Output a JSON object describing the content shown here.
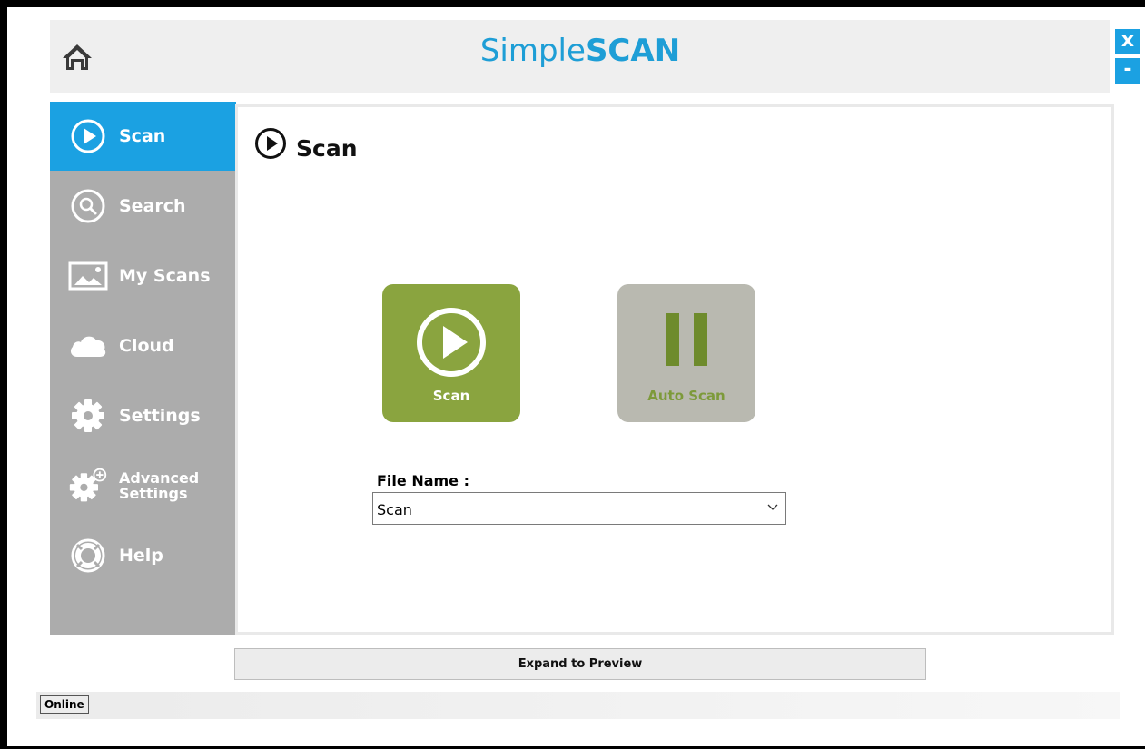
{
  "app": {
    "title_light": "Simple",
    "title_bold": "SCAN",
    "close_glyph": "x",
    "minimize_glyph": "-"
  },
  "colors": {
    "accent": "#1ba1e2",
    "sidebar": "#acacac",
    "scan_tile": "#8aa43f",
    "auto_scan_tile": "#b9b9b0"
  },
  "sidebar": {
    "items": [
      {
        "label": "Scan",
        "icon": "play-circle-icon",
        "active": true
      },
      {
        "label": "Search",
        "icon": "search-icon"
      },
      {
        "label": "My Scans",
        "icon": "image-icon"
      },
      {
        "label": "Cloud",
        "icon": "cloud-icon"
      },
      {
        "label": "Settings",
        "icon": "gear-icon"
      },
      {
        "label_line1": "Advanced",
        "label_line2": "Settings",
        "icon": "gear-plus-icon"
      },
      {
        "label": "Help",
        "icon": "lifebuoy-icon"
      }
    ]
  },
  "main": {
    "title": "Scan",
    "scan_button": {
      "label": "Scan",
      "icon": "play-circle-icon"
    },
    "auto_scan_button": {
      "label": "Auto Scan",
      "icon": "pause-icon"
    },
    "file_name": {
      "label": "File Name :",
      "value": "Scan"
    }
  },
  "footer": {
    "expand_label": "Expand to Preview",
    "status": "Online"
  }
}
